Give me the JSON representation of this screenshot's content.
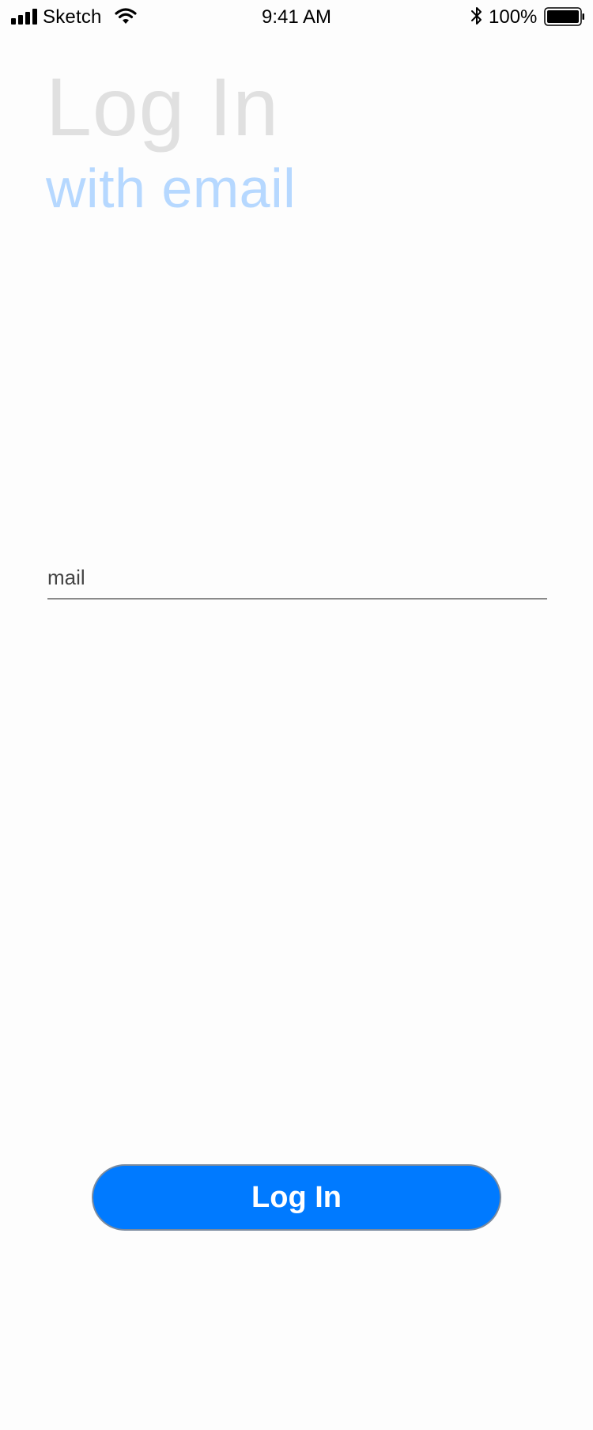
{
  "status_bar": {
    "carrier": "Sketch",
    "time": "9:41 AM",
    "battery_percent": "100%",
    "icons": [
      "signal-icon",
      "wifi-icon",
      "bluetooth-icon",
      "battery-icon"
    ]
  },
  "header": {
    "title": "Log In",
    "subtitle": "with email"
  },
  "form": {
    "email_placeholder": "mail",
    "email_value": ""
  },
  "actions": {
    "login_label": "Log In"
  },
  "colors": {
    "accent": "#007aff",
    "title": "#e0e0e0",
    "subtitle": "#b6d8ff",
    "background": "#fdfdfd"
  }
}
